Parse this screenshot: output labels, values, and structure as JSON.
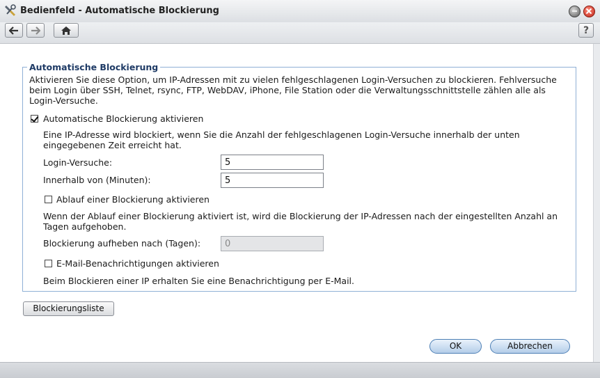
{
  "window": {
    "title": "Bedienfeld - Automatische Blockierung",
    "app_icon": "control-panel-icon",
    "controls": [
      "minimize-icon",
      "close-icon"
    ]
  },
  "toolbar": {
    "back": "arrow-left-icon",
    "forward": "arrow-right-icon",
    "home": "home-icon",
    "help": "?"
  },
  "group": {
    "legend": "Automatische Blockierung",
    "description": "Aktivieren Sie diese Option, um IP-Adressen mit zu vielen fehlgeschlagenen Login-Versuchen zu blockieren. Fehlversuche beim Login über SSH, Telnet, rsync, FTP, WebDAV, iPhone, File Station oder die Verwaltungsschnittstelle zählen alle als Login-Versuche.",
    "enable": {
      "label": "Automatische Blockierung aktivieren",
      "checked": true
    },
    "block_info": "Eine IP-Adresse wird blockiert, wenn Sie die Anzahl der fehlgeschlagenen Login-Versuche innerhalb der unten eingegebenen Zeit erreicht hat.",
    "login_attempts": {
      "label": "Login-Versuche:",
      "value": "5"
    },
    "within_minutes": {
      "label": "Innerhalb von (Minuten):",
      "value": "5"
    },
    "expiry": {
      "label": "Ablauf einer Blockierung aktivieren",
      "checked": false
    },
    "expiry_info": "Wenn der Ablauf einer Blockierung aktiviert ist, wird die Blockierung der IP-Adressen nach der eingestellten Anzahl an Tagen aufgehoben.",
    "unblock_days": {
      "label": "Blockierung aufheben nach (Tagen):",
      "value": "0"
    },
    "email": {
      "label": "E-Mail-Benachrichtigungen aktivieren",
      "checked": false
    },
    "email_info": "Beim Blockieren einer IP erhalten Sie eine Benachrichtigung per E-Mail."
  },
  "buttons": {
    "blocklist": "Blockierungsliste",
    "ok": "OK",
    "cancel": "Abbrechen"
  }
}
